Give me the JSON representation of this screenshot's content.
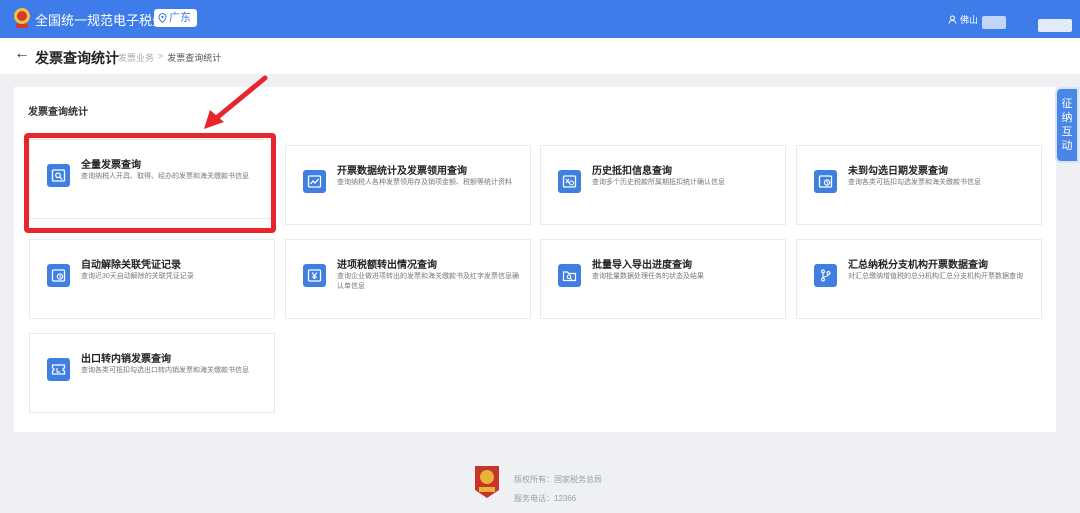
{
  "header": {
    "app_title": "全国统一规范电子税务局",
    "region": "广东",
    "user": "佛山"
  },
  "page": {
    "back_icon": "←",
    "title": "发票查询统计",
    "breadcrumb": [
      "发票业务",
      "发票查询统计"
    ]
  },
  "section_title": "发票查询统计",
  "cards": [
    {
      "title": "全量发票查询",
      "desc": "查询纳税人开具、取得、经办的发票和海关缴款书信息",
      "icon": "search-doc-icon"
    },
    {
      "title": "开票数据统计及发票领用查询",
      "desc": "查询纳税人各种发票领用存及销项金额、税额等统计资料",
      "icon": "chart-doc-icon"
    },
    {
      "title": "历史抵扣信息查询",
      "desc": "查询多个历史税款所属期抵扣统计确认信息",
      "icon": "history-search-icon"
    },
    {
      "title": "未到勾选日期发票查询",
      "desc": "查询各类可抵扣勾选发票和海关缴款书信息",
      "icon": "clock-doc-icon"
    },
    {
      "title": "自动解除关联凭证记录",
      "desc": "查询近30天自动解除的关联凭证记录",
      "icon": "clock-doc-icon"
    },
    {
      "title": "进项税额转出情况查询",
      "desc": "查询企业做进项转出的发票和海关缴款书及红字发票信息确认单信息",
      "icon": "yen-doc-icon"
    },
    {
      "title": "批量导入导出进度查询",
      "desc": "查询批量数据处理任务的状态及结果",
      "icon": "folder-search-icon"
    },
    {
      "title": "汇总纳税分支机构开票数据查询",
      "desc": "对汇总缴纳增值税的总分机构汇总分支机构开票数据查询",
      "icon": "branch-icon"
    },
    {
      "title": "出口转内销发票查询",
      "desc": "查询各类可抵扣勾选出口转内销发票和海关缴款书信息",
      "icon": "ticket-icon"
    }
  ],
  "side_tab": [
    "征",
    "纳",
    "互",
    "动"
  ],
  "footer": {
    "copyright": "版权所有：国家税务总局",
    "hotline": "服务电话：12366",
    "emblem_text": "税务"
  },
  "colors": {
    "primary": "#3d7ce9",
    "highlight": "#e8252a",
    "icon_bg": "#3f7fe0"
  }
}
